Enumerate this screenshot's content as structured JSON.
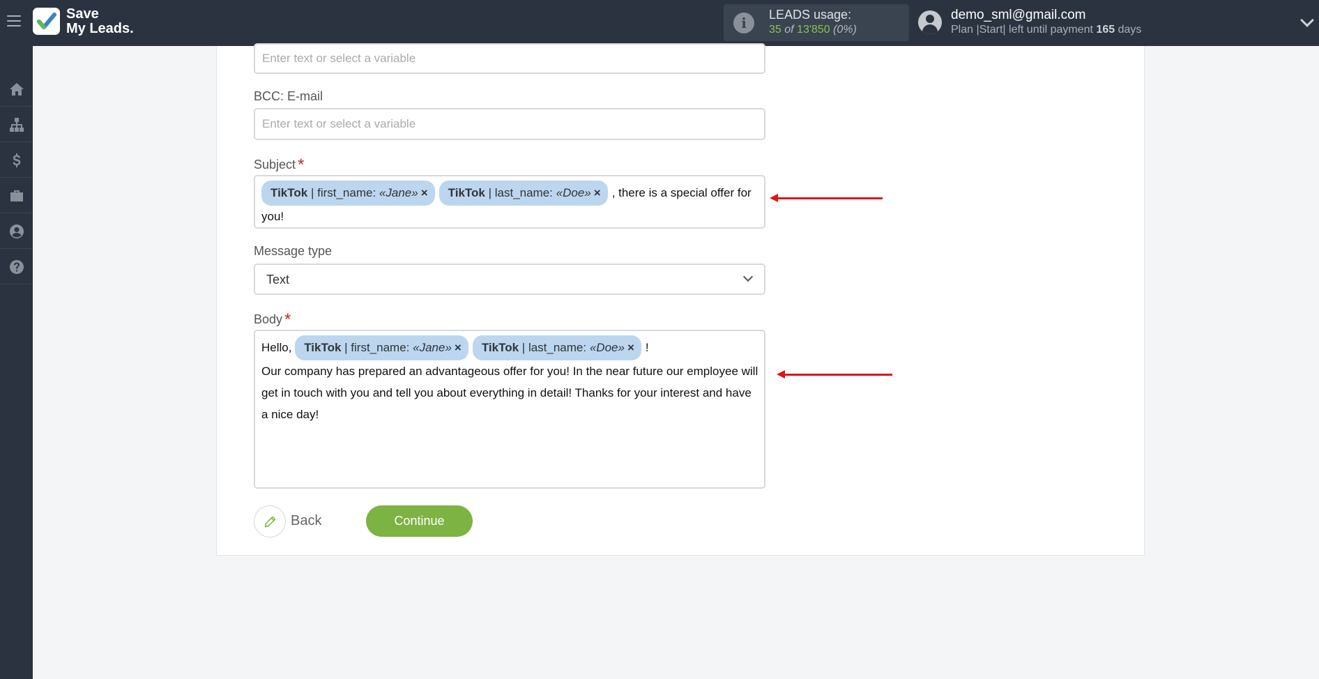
{
  "brand": {
    "line1": "Save",
    "line2": "My Leads."
  },
  "usage": {
    "title": "LEADS usage:",
    "used": "35",
    "of": "of",
    "total": "13'850",
    "percent": "(0%)"
  },
  "account": {
    "email": "demo_sml@gmail.com",
    "plan_prefix": "Plan |Start| left until payment",
    "days": "165",
    "days_suffix": "days"
  },
  "sidebar": {
    "items": [
      {
        "icon": "home-icon"
      },
      {
        "icon": "sitemap-icon"
      },
      {
        "icon": "dollar-icon"
      },
      {
        "icon": "briefcase-icon"
      },
      {
        "icon": "user-icon"
      },
      {
        "icon": "help-icon"
      }
    ]
  },
  "form": {
    "cc": {
      "placeholder": "Enter text or select a variable"
    },
    "bcc": {
      "label": "BCC: E-mail",
      "placeholder": "Enter text or select a variable"
    },
    "subject": {
      "label": "Subject",
      "required": "*",
      "tags": [
        {
          "source": "TikTok",
          "field": "first_name:",
          "value": "«Jane»",
          "remove": "×"
        },
        {
          "source": "TikTok",
          "field": "last_name:",
          "value": "«Doe»",
          "remove": "×"
        }
      ],
      "text": ", there is a special offer for you!"
    },
    "message_type": {
      "label": "Message type",
      "value": "Text"
    },
    "body": {
      "label": "Body",
      "required": "*",
      "greeting": "Hello,",
      "tags": [
        {
          "source": "TikTok",
          "field": "first_name:",
          "value": "«Jane»",
          "remove": "×"
        },
        {
          "source": "TikTok",
          "field": "last_name:",
          "value": "«Doe»",
          "remove": "×"
        }
      ],
      "after_tags": "!",
      "text": "Our company has prepared an advantageous offer for you! In the near future our employee will get in touch with you and tell you about everything in detail! Thanks for your interest and have a nice day!"
    }
  },
  "actions": {
    "back": "Back",
    "continue": "Continue"
  },
  "colors": {
    "accent": "#7cb342",
    "topbar": "#2b3340",
    "tag": "#bcd6ef",
    "arrow": "#e1141b"
  }
}
